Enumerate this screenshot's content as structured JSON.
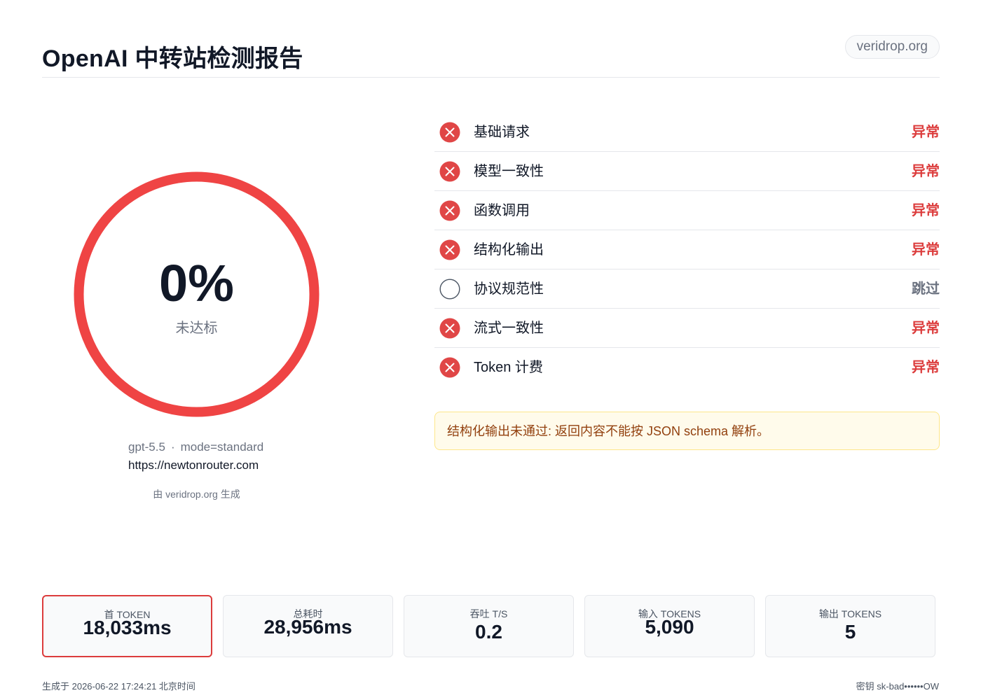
{
  "header": {
    "title": "OpenAI 中转站检测报告",
    "domain_badge": "veridrop.org"
  },
  "score": {
    "value": "0%",
    "label": "未达标",
    "fraction": 0,
    "ring_color": "#ef4444"
  },
  "meta": {
    "model": "gpt-5.5",
    "separator": "·",
    "mode": "mode=standard",
    "url": "https://newtonrouter.com",
    "generated_by": "由 veridrop.org 生成"
  },
  "checks": [
    {
      "label": "基础请求",
      "status": "异常",
      "state": "fail",
      "icon": "x-circle-icon"
    },
    {
      "label": "模型一致性",
      "status": "异常",
      "state": "fail",
      "icon": "x-circle-icon"
    },
    {
      "label": "函数调用",
      "status": "异常",
      "state": "fail",
      "icon": "x-circle-icon"
    },
    {
      "label": "结构化输出",
      "status": "异常",
      "state": "fail",
      "icon": "x-circle-icon"
    },
    {
      "label": "协议规范性",
      "status": "跳过",
      "state": "skip",
      "icon": "empty-circle-icon"
    },
    {
      "label": "流式一致性",
      "status": "异常",
      "state": "fail",
      "icon": "x-circle-icon"
    },
    {
      "label": "Token 计费",
      "status": "异常",
      "state": "fail",
      "icon": "x-circle-icon"
    }
  ],
  "alert": {
    "text": "结构化输出未通过: 返回内容不能按 JSON schema 解析。"
  },
  "metrics": [
    {
      "label": "首 TOKEN",
      "value": "18,033ms",
      "highlight": true
    },
    {
      "label": "总耗时",
      "value": "28,956ms",
      "highlight": false
    },
    {
      "label": "吞吐 T/S",
      "value": "0.2",
      "highlight": false
    },
    {
      "label": "输入 TOKENS",
      "value": "5,090",
      "highlight": false
    },
    {
      "label": "输出 TOKENS",
      "value": "5",
      "highlight": false
    }
  ],
  "footer": {
    "generated_at": "生成于 2026-06-22 17:24:21 北京时间",
    "key": "密钥 sk-bad••••••OW"
  },
  "colors": {
    "fail": "#dc3c3c",
    "skip": "#6b7280",
    "alert_bg": "#fffbeb",
    "alert_border": "#fde68a",
    "alert_text": "#92400e"
  }
}
